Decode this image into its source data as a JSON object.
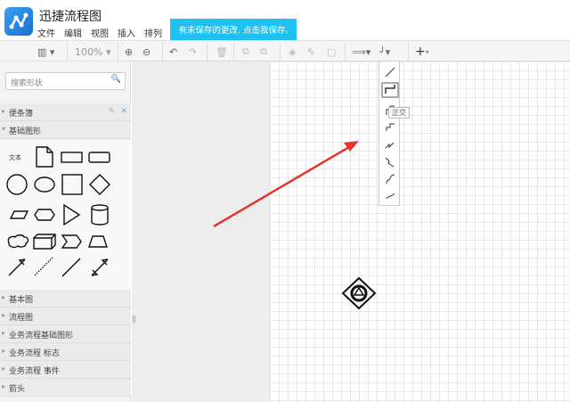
{
  "app": {
    "title": "迅捷流程图",
    "menu": [
      "文件",
      "编辑",
      "视图",
      "插入",
      "排列"
    ],
    "save_notice": "有未保存的更改. 点击我保存."
  },
  "toolbar": {
    "zoom": "100%"
  },
  "sidebar": {
    "search_placeholder": "搜索形状",
    "scratchpad": "便条簿",
    "basic_shapes": "基础图形",
    "text_shape": "文本",
    "sections": [
      "基本图",
      "流程图",
      "业务流程基础图形",
      "业务流程 标志",
      "业务流程 事件",
      "箭头"
    ]
  },
  "popup": {
    "tooltip": "正交"
  },
  "colors": {
    "accent": "#1fc1f0",
    "arrow": "#e8322a"
  }
}
